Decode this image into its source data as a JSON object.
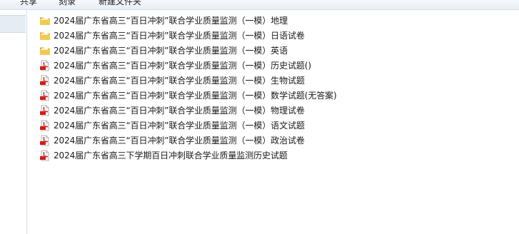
{
  "toolbar": {
    "items": [
      "共享",
      "刻录",
      "新建文件夹"
    ]
  },
  "nav": {
    "selected_item": ""
  },
  "files": [
    {
      "name": "2024届广东省高三“百日冲刺”联合学业质量监测（一模）地理",
      "type": "folder",
      "icon": "folder-icon"
    },
    {
      "name": "2024届广东省高三“百日冲刺”联合学业质量监测（一模）日语试卷",
      "type": "folder",
      "icon": "folder-icon"
    },
    {
      "name": "2024届广东省高三“百日冲刺”联合学业质量监测（一模）英语",
      "type": "folder",
      "icon": "folder-icon"
    },
    {
      "name": "2024届广东省高三“百日冲刺”联合学业质量监测（一模）历史试题()",
      "type": "pdf",
      "icon": "pdf-icon"
    },
    {
      "name": "2024届广东省高三“百日冲刺”联合学业质量监测（一模）生物试题",
      "type": "pdf",
      "icon": "pdf-icon"
    },
    {
      "name": "2024届广东省高三“百日冲刺”联合学业质量监测（一模）数学试题(无答案)",
      "type": "pdf",
      "icon": "pdf-icon"
    },
    {
      "name": "2024届广东省高三“百日冲刺”联合学业质量监测（一模）物理试卷",
      "type": "pdf",
      "icon": "pdf-icon"
    },
    {
      "name": "2024届广东省高三“百日冲刺”联合学业质量监测（一模）语文试题",
      "type": "pdf",
      "icon": "pdf-icon"
    },
    {
      "name": "2024届广东省高三“百日冲刺”联合学业质量监测（一模）政治试卷",
      "type": "pdf",
      "icon": "pdf-icon"
    },
    {
      "name": "2024届广东省高三下学期百日冲刺联合学业质量监测历史试题",
      "type": "pdf",
      "icon": "pdf-icon"
    }
  ],
  "colors": {
    "folder": "#e8b93a",
    "pdf_red": "#d41c1c",
    "nav_selected": "#e6ecf4"
  }
}
